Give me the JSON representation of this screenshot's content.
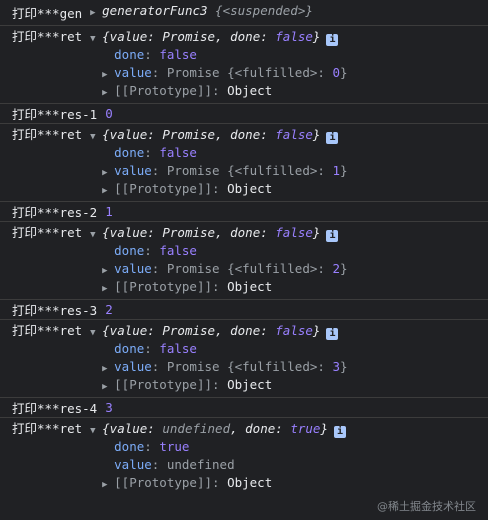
{
  "gen": {
    "label": "打印***gen",
    "fn": "generatorFunc3",
    "state": "{<suspended>}"
  },
  "entries": [
    {
      "kind": "ret",
      "label": "打印***ret",
      "summary_prefix": "{value: ",
      "summary_value": "Promise",
      "summary_mid": ", done: ",
      "summary_done": "false",
      "summary_end": "}",
      "done_key": "done",
      "done_val": "false",
      "value_key": "value",
      "value_text": "Promise {<fulfilled>: ",
      "value_num": "0",
      "value_close": "}",
      "proto_key": "[[Prototype]]",
      "proto_val": "Object"
    },
    {
      "kind": "res",
      "label": "打印***res-1",
      "val": "0"
    },
    {
      "kind": "ret",
      "label": "打印***ret",
      "summary_prefix": "{value: ",
      "summary_value": "Promise",
      "summary_mid": ", done: ",
      "summary_done": "false",
      "summary_end": "}",
      "done_key": "done",
      "done_val": "false",
      "value_key": "value",
      "value_text": "Promise {<fulfilled>: ",
      "value_num": "1",
      "value_close": "}",
      "proto_key": "[[Prototype]]",
      "proto_val": "Object"
    },
    {
      "kind": "res",
      "label": "打印***res-2",
      "val": "1"
    },
    {
      "kind": "ret",
      "label": "打印***ret",
      "summary_prefix": "{value: ",
      "summary_value": "Promise",
      "summary_mid": ", done: ",
      "summary_done": "false",
      "summary_end": "}",
      "done_key": "done",
      "done_val": "false",
      "value_key": "value",
      "value_text": "Promise {<fulfilled>: ",
      "value_num": "2",
      "value_close": "}",
      "proto_key": "[[Prototype]]",
      "proto_val": "Object"
    },
    {
      "kind": "res",
      "label": "打印***res-3",
      "val": "2"
    },
    {
      "kind": "ret",
      "label": "打印***ret",
      "summary_prefix": "{value: ",
      "summary_value": "Promise",
      "summary_mid": ", done: ",
      "summary_done": "false",
      "summary_end": "}",
      "done_key": "done",
      "done_val": "false",
      "value_key": "value",
      "value_text": "Promise {<fulfilled>: ",
      "value_num": "3",
      "value_close": "}",
      "proto_key": "[[Prototype]]",
      "proto_val": "Object"
    },
    {
      "kind": "res",
      "label": "打印***res-4",
      "val": "3"
    },
    {
      "kind": "ret_last",
      "label": "打印***ret",
      "summary_prefix": "{value: ",
      "summary_value": "undefined",
      "summary_mid": ", done: ",
      "summary_done": "true",
      "summary_end": "}",
      "done_key": "done",
      "done_val": "true",
      "value_key": "value",
      "value_text": "undefined",
      "proto_key": "[[Prototype]]",
      "proto_val": "Object"
    }
  ],
  "icons": {
    "expand": "triangle-right-icon",
    "collapse": "triangle-down-icon",
    "info": "info-icon"
  },
  "watermark": "@稀土掘金技术社区",
  "colors": {
    "background": "#202124",
    "purple": "#9980ff",
    "blue_key": "#7cacf8",
    "info_badge": "#a8c7fa"
  }
}
